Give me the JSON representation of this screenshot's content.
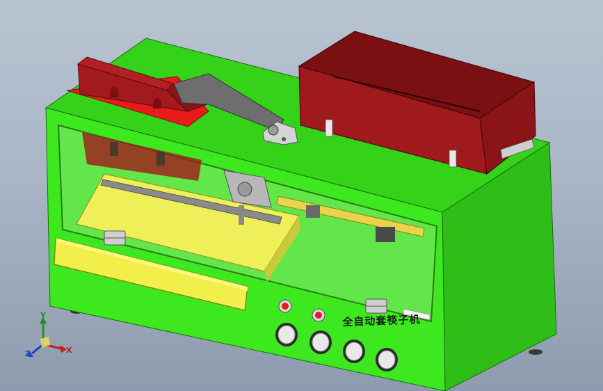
{
  "machine": {
    "label": "全自动套筷子机"
  },
  "triad": {
    "x_label": "X",
    "y_label": "Y",
    "z_label": "Z"
  },
  "colors": {
    "body_green": "#39e61c",
    "body_dark": "#1fb514",
    "hopper_red": "#a0191c",
    "tray_yellow": "#efef5a",
    "background": "#aab6c6"
  }
}
